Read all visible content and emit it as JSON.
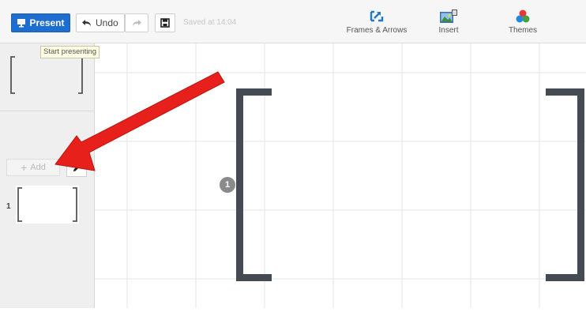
{
  "toolbar": {
    "present_label": "Present",
    "undo_label": "Undo",
    "saved_text": "Saved at 14:04",
    "tools": {
      "frames_label": "Frames & Arrows",
      "insert_label": "Insert",
      "themes_label": "Themes"
    }
  },
  "tooltip": {
    "text": "Start presenting"
  },
  "sidebar": {
    "add_label": "Add",
    "slides": [
      {
        "number": "1"
      }
    ]
  },
  "canvas": {
    "frame_number": "1"
  },
  "colors": {
    "primary": "#1d6ecf",
    "frame": "#454b53",
    "arrow": "#e8201c",
    "grid": "#e6e6e6"
  },
  "icons": {
    "present": "projector-icon",
    "undo": "undo-arrow-icon",
    "redo": "redo-arrow-icon",
    "save": "floppy-disk-icon",
    "frames": "frame-arrow-icon",
    "insert": "image-insert-icon",
    "themes": "palette-icon",
    "add": "plus-icon",
    "edit": "pencil-icon"
  }
}
